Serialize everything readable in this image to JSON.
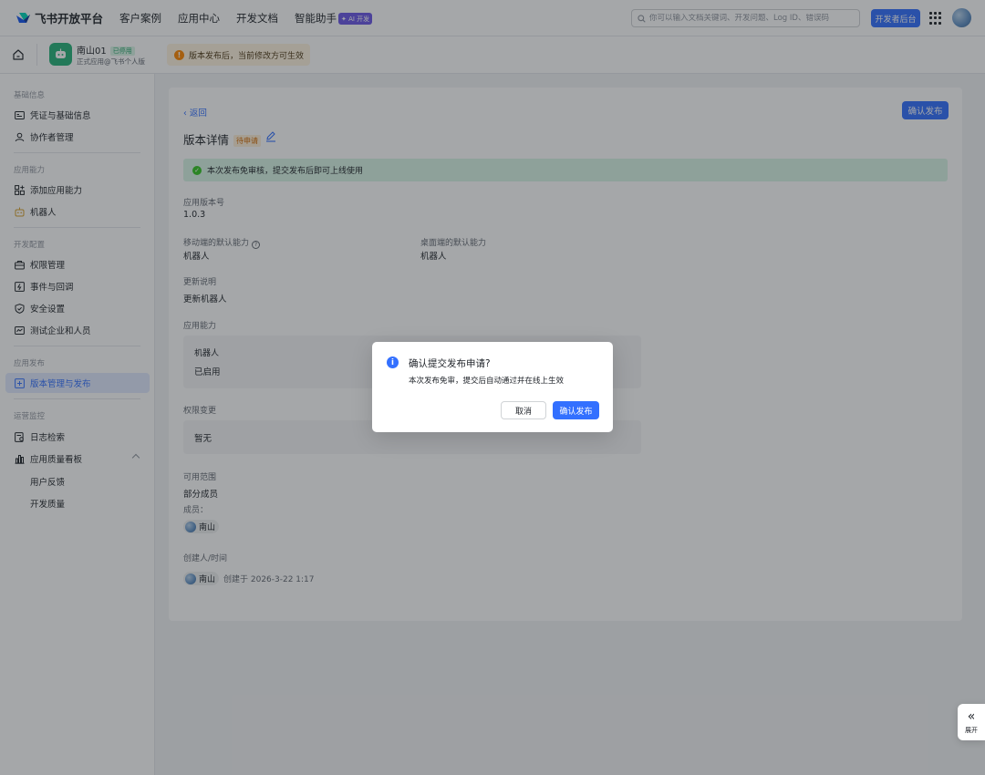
{
  "topnav": {
    "brand": "飞书开放平台",
    "items": [
      "客户案例",
      "应用中心",
      "开发文档",
      "智能助手"
    ],
    "ai_badge": "✦ AI 开发",
    "search_placeholder": "你可以输入文档关键词、开发问题、Log ID、错误码",
    "dev_console": "开发者后台"
  },
  "app": {
    "name": "南山01",
    "status": "已停用",
    "subtitle": "正式应用@飞书个人版",
    "notice": "版本发布后，当前修改方可生效"
  },
  "sidebar": {
    "groups": [
      "基础信息",
      "应用能力",
      "开发配置",
      "应用发布",
      "运营监控"
    ],
    "items": [
      "凭证与基础信息",
      "协作者管理",
      "添加应用能力",
      "机器人",
      "权限管理",
      "事件与回调",
      "安全设置",
      "测试企业和人员",
      "版本管理与发布",
      "日志检索",
      "应用质量看板"
    ],
    "subitems": [
      "用户反馈",
      "开发质量"
    ]
  },
  "main": {
    "back": "返回",
    "publish_btn": "确认发布",
    "title": "版本详情",
    "title_status": "待申请",
    "success_msg": "本次发布免审核，提交发布后即可上线使用",
    "version_label": "应用版本号",
    "version_value": "1.0.3",
    "mobile_label": "移动端的默认能力",
    "mobile_value": "机器人",
    "desktop_label": "桌面端的默认能力",
    "desktop_value": "机器人",
    "notes_label": "更新说明",
    "notes_value": "更新机器人",
    "cap_label": "应用能力",
    "cap_name": "机器人",
    "cap_status": "已启用",
    "perm_label": "权限变更",
    "perm_value": "暂无",
    "scope_label": "可用范围",
    "scope_value": "部分成员",
    "members_label": "成员：",
    "member_name": "南山",
    "creator_label": "创建人/时间",
    "creator_name": "南山",
    "created_at": "创建于 2026-3-22 1:17"
  },
  "dialog": {
    "title": "确认提交发布申请?",
    "body": "本次发布免审，提交后自动通过并在线上生效",
    "cancel": "取消",
    "confirm": "确认发布"
  },
  "expand": {
    "label": "展开",
    "icon": "«"
  }
}
